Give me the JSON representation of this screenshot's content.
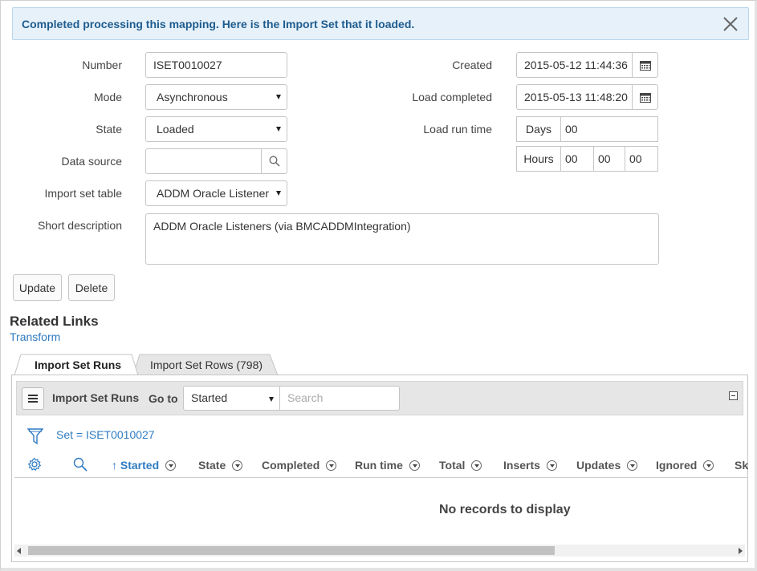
{
  "banner": {
    "message": "Completed processing this mapping. Here is the Import Set that it loaded."
  },
  "form": {
    "number": {
      "label": "Number",
      "value": "ISET0010027"
    },
    "mode": {
      "label": "Mode",
      "value": "Asynchronous"
    },
    "state": {
      "label": "State",
      "value": "Loaded"
    },
    "data_source": {
      "label": "Data source",
      "value": ""
    },
    "import_set_table": {
      "label": "Import set table",
      "value": "ADDM Oracle Listeners"
    },
    "short_description": {
      "label": "Short description",
      "value": "ADDM Oracle Listeners (via BMCADDMIntegration)"
    },
    "created": {
      "label": "Created",
      "value": "2015-05-12 11:44:36"
    },
    "load_completed": {
      "label": "Load completed",
      "value": "2015-05-13 11:48:20"
    },
    "load_run_time": {
      "label": "Load run time",
      "days_label": "Days",
      "days": "00",
      "hours_label": "Hours",
      "hours": "00",
      "minutes": "00",
      "seconds": "00"
    }
  },
  "actions": {
    "update": "Update",
    "delete": "Delete"
  },
  "related_links": {
    "title": "Related Links",
    "transform": "Transform"
  },
  "tabs": [
    {
      "label": "Import Set Runs",
      "active": true
    },
    {
      "label": "Import Set Rows (798)",
      "active": false
    }
  ],
  "list": {
    "title": "Import Set Runs",
    "goto_label": "Go to",
    "goto_field": "Started",
    "search_placeholder": "Search",
    "filter": "Set = ISET0010027",
    "columns": [
      "Started",
      "State",
      "Completed",
      "Run time",
      "Total",
      "Inserts",
      "Updates",
      "Ignored",
      "Sk"
    ],
    "sorted_column": "Started",
    "empty_message": "No records to display"
  },
  "colors": {
    "accent": "#2f7bc2",
    "banner_bg": "#e6f1fa",
    "banner_text": "#1f5c8e"
  }
}
